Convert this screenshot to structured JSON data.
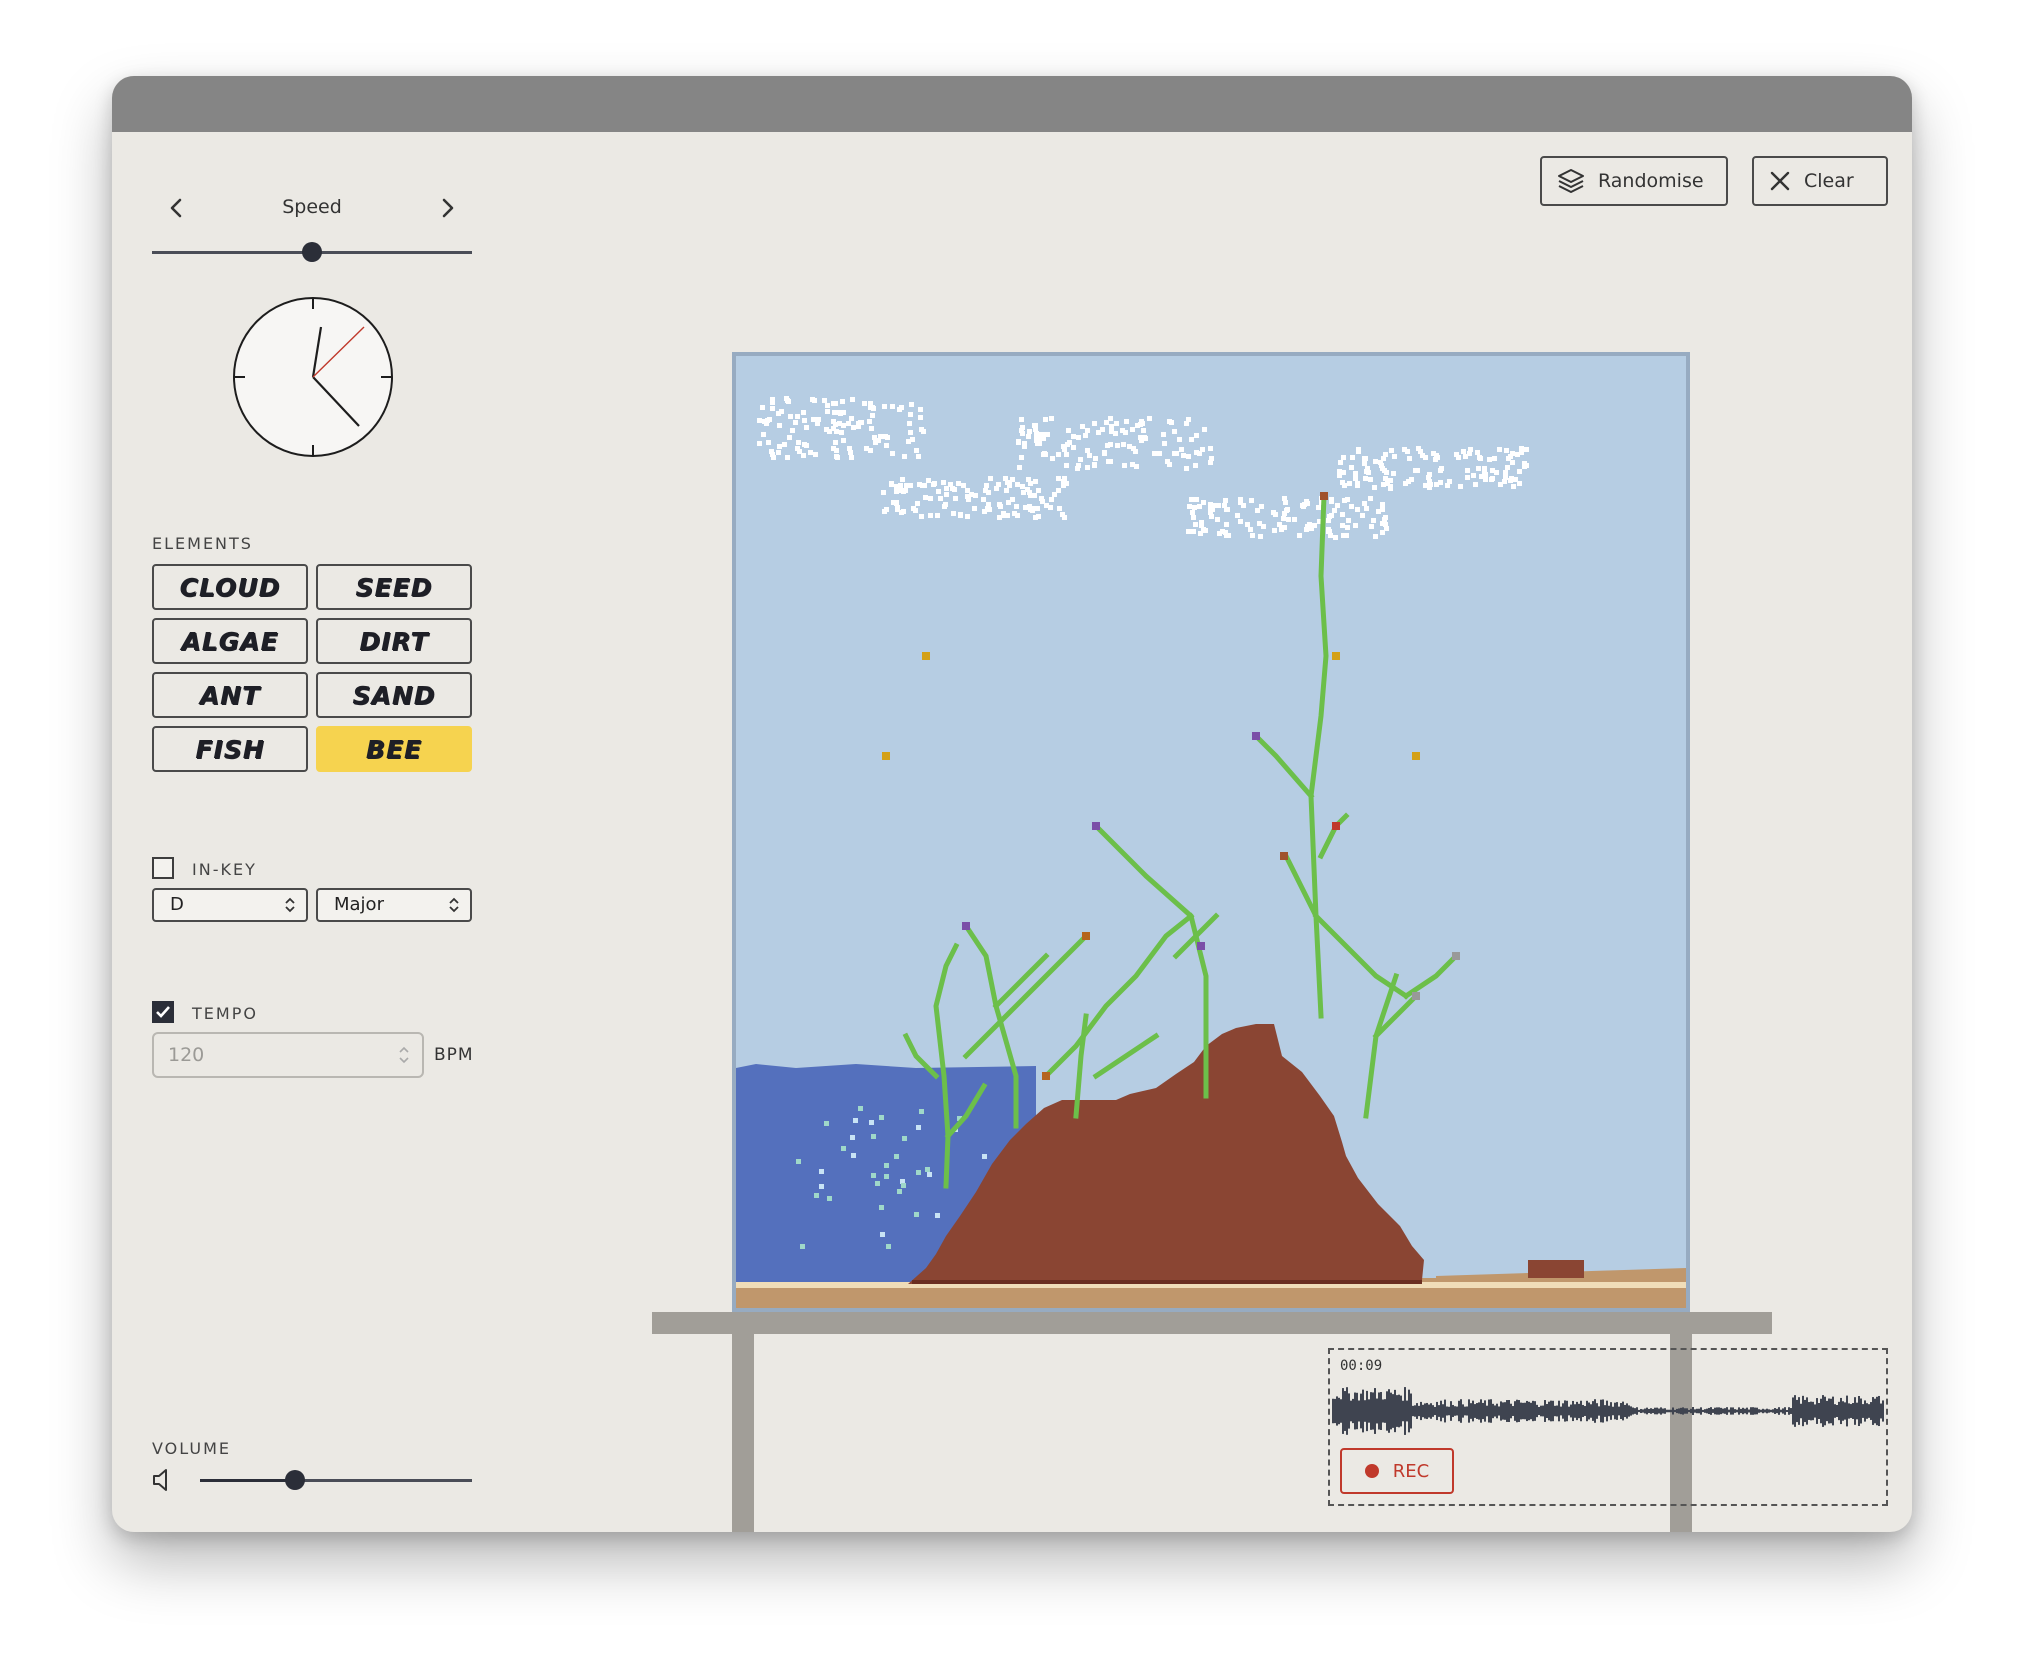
{
  "speed": {
    "label": "Speed",
    "value": 0.5
  },
  "elements": {
    "label": "ELEMENTS",
    "items": [
      {
        "label": "CLOUD",
        "selected": false
      },
      {
        "label": "SEED",
        "selected": false
      },
      {
        "label": "ALGAE",
        "selected": false
      },
      {
        "label": "DIRT",
        "selected": false
      },
      {
        "label": "ANT",
        "selected": false
      },
      {
        "label": "SAND",
        "selected": false
      },
      {
        "label": "FISH",
        "selected": false
      },
      {
        "label": "BEE",
        "selected": true
      }
    ]
  },
  "in_key": {
    "label": "IN-KEY",
    "checked": false,
    "key": "D",
    "mode": "Major"
  },
  "tempo": {
    "label": "TEMPO",
    "checked": true,
    "value": "120",
    "unit": "BPM"
  },
  "volume": {
    "label": "VOLUME",
    "value": 0.35
  },
  "toolbar": {
    "randomise_label": "Randomise",
    "clear_label": "Clear"
  },
  "recorder": {
    "time": "00:09",
    "rec_label": "REC"
  },
  "colors": {
    "sky": "#b6cde3",
    "water": "#5470bd",
    "dirt": "#8a4533",
    "sand": "#c0976c",
    "plant": "#6cbf4a",
    "selected": "#f6d34f",
    "rec": "#c0392b"
  },
  "icons": {
    "prev": "chevron-left-icon",
    "next": "chevron-right-icon",
    "randomise": "layers-icon",
    "clear": "close-icon",
    "volume": "speaker-icon",
    "rec": "record-dot-icon"
  }
}
